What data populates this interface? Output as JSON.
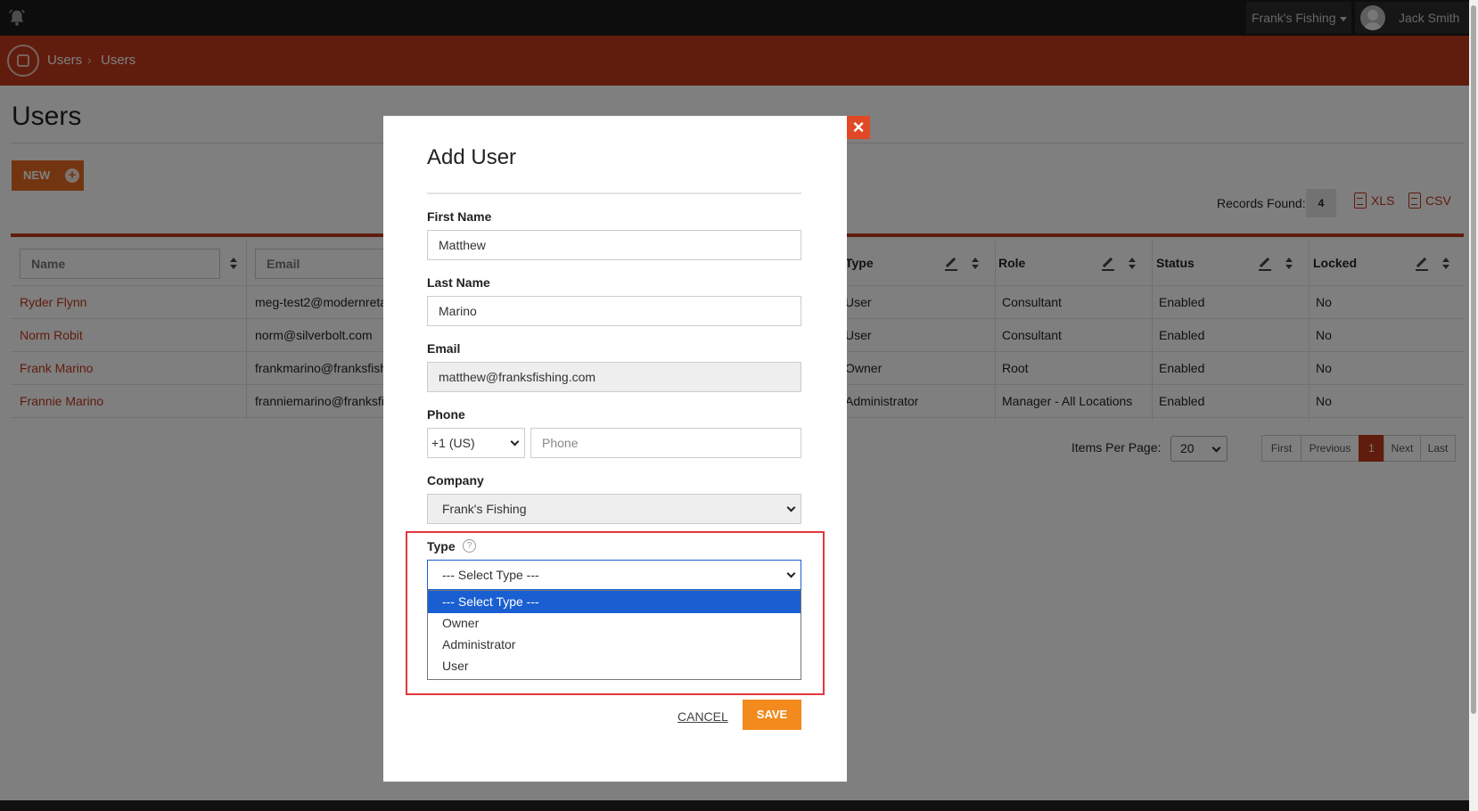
{
  "topbar": {
    "company": "Frank's Fishing",
    "user_name": "Jack Smith"
  },
  "breadcrumb": [
    "Users",
    "Users"
  ],
  "page": {
    "title": "Users",
    "new_label": "NEW",
    "records_label": "Records Found:",
    "records_count": "4",
    "export_xls": "XLS",
    "export_csv": "CSV"
  },
  "table": {
    "filters": {
      "name_placeholder": "Name",
      "email_placeholder": "Email"
    },
    "headers": [
      "Type",
      "Role",
      "Status",
      "Locked"
    ],
    "rows": [
      {
        "name": "Ryder Flynn",
        "email": "meg-test2@modernreta",
        "type": "User",
        "role": "Consultant",
        "status": "Enabled",
        "locked": "No"
      },
      {
        "name": "Norm Robit",
        "email": "norm@silverbolt.com",
        "type": "User",
        "role": "Consultant",
        "status": "Enabled",
        "locked": "No"
      },
      {
        "name": "Frank Marino",
        "email": "frankmarino@franksfish",
        "type": "Owner",
        "role": "Root",
        "status": "Enabled",
        "locked": "No"
      },
      {
        "name": "Frannie Marino",
        "email": "franniemarino@franksfi",
        "type": "Administrator",
        "role": "Manager - All Locations",
        "status": "Enabled",
        "locked": "No"
      }
    ]
  },
  "pagination": {
    "items_per_page_label": "Items Per Page:",
    "items_per_page": "20",
    "first": "First",
    "previous": "Previous",
    "current": "1",
    "next": "Next",
    "last": "Last"
  },
  "modal": {
    "title": "Add User",
    "close": "×",
    "first_name_label": "First Name",
    "first_name_value": "Matthew",
    "last_name_label": "Last Name",
    "last_name_value": "Marino",
    "email_label": "Email",
    "email_value": "matthew@franksfishing.com",
    "phone_label": "Phone",
    "phone_country": "+1 (US)",
    "phone_placeholder": "Phone",
    "company_label": "Company",
    "company_value": "Frank's Fishing",
    "type_label": "Type",
    "type_help": "?",
    "type_value": "--- Select Type ---",
    "type_options": [
      "--- Select Type ---",
      "Owner",
      "Administrator",
      "User"
    ],
    "cancel_label": "CANCEL",
    "save_label": "SAVE"
  },
  "colors": {
    "brand_red": "#c0391b",
    "orange": "#f28a1e",
    "highlight": "#e0383e",
    "select_blue": "#1a5fd1"
  }
}
